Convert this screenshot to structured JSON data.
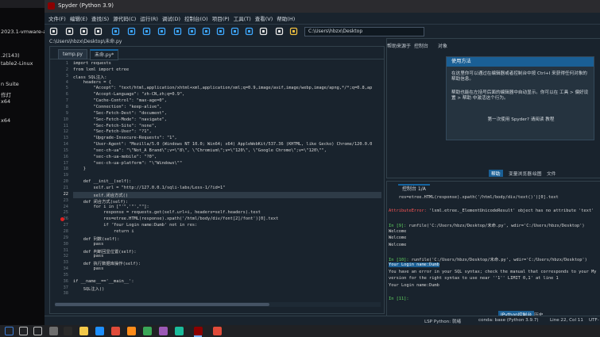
{
  "left_strip": {
    "items": [
      "2023.1-vmware-amd",
      ".2(143)",
      "table2-Linux",
      "n Suite",
      "作灯",
      "x64",
      "x64"
    ]
  },
  "window": {
    "title": "Spyder (Python 3.9)"
  },
  "menu": [
    "文件(F)",
    "编辑(E)",
    "查找(S)",
    "源代码(C)",
    "运行(R)",
    "调试(D)",
    "控制台(O)",
    "项目(P)",
    "工具(T)",
    "查看(V)",
    "帮助(H)"
  ],
  "toolbar": {
    "path": "C:\\Users\\hbzx\\Desktop",
    "icons": [
      "new-file-icon",
      "open-folder-icon",
      "save-icon",
      "save-all-icon",
      "run-file-icon",
      "run-cell-icon",
      "run-cell-advance-icon",
      "run-selection-icon",
      "debug-icon",
      "step-over-icon",
      "step-into-icon",
      "step-return-icon",
      "continue-icon",
      "stop-icon",
      "maximize-icon",
      "wrench-icon",
      "python-path-icon"
    ]
  },
  "breadcrumb": "C:\\Users\\hbzx\\Desktop\\未命.py",
  "editor": {
    "tabs": [
      {
        "label": "temp.py",
        "active": false
      },
      {
        "label": "未命.py*",
        "active": true
      }
    ],
    "lines": [
      {
        "n": "1",
        "t": "import requests"
      },
      {
        "n": "2",
        "t": "from lxml import etree"
      },
      {
        "n": "3",
        "t": "class SQL注入:"
      },
      {
        "n": "4",
        "t": "    headers = {"
      },
      {
        "n": "5",
        "t": "        \"Accept\": \"text/html,application/xhtml+xml,application/xml;q=0.9,image/avif,image/webp,image/apng,*/*;q=0.8,ap"
      },
      {
        "n": "6",
        "t": "        \"Accept-Language\": \"zh-CN,zh;q=0.9\","
      },
      {
        "n": "7",
        "t": "        \"Cache-Control\": \"max-age=0\","
      },
      {
        "n": "8",
        "t": "        \"Connection\": \"keep-alive\","
      },
      {
        "n": "9",
        "t": "        \"Sec-Fetch-Dest\": \"document\","
      },
      {
        "n": "10",
        "t": "        \"Sec-Fetch-Mode\": \"navigate\","
      },
      {
        "n": "11",
        "t": "        \"Sec-Fetch-Site\": \"none\","
      },
      {
        "n": "12",
        "t": "        \"Sec-Fetch-User\": \"?1\","
      },
      {
        "n": "13",
        "t": "        \"Upgrade-Insecure-Requests\": \"1\","
      },
      {
        "n": "14",
        "t": "        \"User-Agent\": \"Mozilla/5.0 (Windows NT 10.0; Win64; x64) AppleWebKit/537.36 (KHTML, like Gecko) Chrome/120.0.0"
      },
      {
        "n": "15",
        "t": "        \"sec-ch-ua\": \"\\\"Not_A Brand\\\";v=\\\"8\\\", \\\"Chromium\\\";v=\\\"120\\\", \\\"Google Chrome\\\";v=\\\"120\\\"\","
      },
      {
        "n": "16",
        "t": "        \"sec-ch-ua-mobile\": \"?0\","
      },
      {
        "n": "17",
        "t": "        \"sec-ch-ua-platform\": \"\\\"Windows\\\"\""
      },
      {
        "n": "18",
        "t": "    }"
      },
      {
        "n": "19",
        "t": ""
      },
      {
        "n": "20",
        "t": "    def __init__(self):"
      },
      {
        "n": "21",
        "t": "        self.url = \"http://127.0.0.1/sqli-labs/Less-1/?id=1\""
      },
      {
        "n": "22",
        "t": "        self.闭合方式()"
      },
      {
        "n": "23",
        "t": "    def 闭合方式(self):"
      },
      {
        "n": "24",
        "t": "        for i in [\"'\",'\"',\"\"]:"
      },
      {
        "n": "25",
        "t": "            response = requests.get(self.url+i, headers=self.headers).text"
      },
      {
        "n": "26",
        "t": "            res=etree.HTML(response).xpath('/html/body/div/font[2]/font')[0].text"
      },
      {
        "n": "27",
        "t": "            if 'Your Login name:Dumb' not in res:"
      },
      {
        "n": "28",
        "t": "                return i"
      },
      {
        "n": "29",
        "t": "    def 列数(self):"
      },
      {
        "n": "30",
        "t": "        pass"
      },
      {
        "n": "31",
        "t": "    def 判断回显位置(self):"
      },
      {
        "n": "32",
        "t": "        pass"
      },
      {
        "n": "33",
        "t": "    def 执行数据库操作(self):"
      },
      {
        "n": "34",
        "t": "        pass"
      },
      {
        "n": "35",
        "t": ""
      },
      {
        "n": "36",
        "t": "if __name__=='__main__':"
      },
      {
        "n": "37",
        "t": "    SQL注入()"
      },
      {
        "n": "38",
        "t": ""
      }
    ]
  },
  "help": {
    "tabs": [
      "帮助来源于",
      "控制台",
      "对象"
    ],
    "box_title": "使用方法",
    "p1": "在这里你可以通过在编辑器或者控制台中按 Ctrl+I 来获得任何对象的帮助信息。",
    "p2": "帮助也能在左括号后面的编辑器中自动显示。你可以在 工具 > 偏好设置 > 帮助 中激活这个行为。",
    "p3": "第一次使用 Spyder? 请阅读 教程",
    "bottom_tabs": [
      {
        "label": "帮助",
        "active": true
      },
      {
        "label": "变量浏览器",
        "active": false
      },
      {
        "label": "绘图",
        "active": false
      },
      {
        "label": "文件",
        "active": false
      }
    ]
  },
  "console": {
    "tab": "控制台 1/A",
    "lines": [
      {
        "segs": [
          {
            "c": "",
            "t": "    res=etree.HTML(response).xpath('/html/body/div/text()')[0].text"
          }
        ]
      },
      {
        "segs": [
          {
            "c": "",
            "t": ""
          }
        ]
      },
      {
        "segs": [
          {
            "c": "r",
            "t": "AttributeError: "
          },
          {
            "c": "",
            "t": "'lxml.etree._ElementUnicodeResult' object has no attribute 'text'"
          }
        ]
      },
      {
        "segs": [
          {
            "c": "",
            "t": ""
          }
        ]
      },
      {
        "segs": [
          {
            "c": "g",
            "t": "In [9]: "
          },
          {
            "c": "",
            "t": "runfile('C:/Users/hbzx/Desktop/未命.py', wdir='C:/Users/hbzx/Desktop')"
          }
        ]
      },
      {
        "segs": [
          {
            "c": "",
            "t": "Welcome"
          }
        ]
      },
      {
        "segs": [
          {
            "c": "",
            "t": "Welcome"
          }
        ]
      },
      {
        "segs": [
          {
            "c": "",
            "t": "Welcome"
          }
        ]
      },
      {
        "segs": [
          {
            "c": "",
            "t": ""
          }
        ]
      },
      {
        "segs": [
          {
            "c": "g",
            "t": "In [10]: "
          },
          {
            "c": "",
            "t": "runfile('C:/Users/hbzx/Desktop/未命.py', wdir='C:/Users/hbzx/Desktop')"
          }
        ]
      },
      {
        "segs": [
          {
            "c": "sel",
            "t": "Your Login name:Dumb"
          }
        ]
      },
      {
        "segs": [
          {
            "c": "",
            "t": "You have an error in your SQL syntax; check the manual that corresponds to your My"
          }
        ]
      },
      {
        "segs": [
          {
            "c": "",
            "t": "version for the right syntax to use near ''1'' LIMIT 0,1' at line 1"
          }
        ]
      },
      {
        "segs": [
          {
            "c": "",
            "t": "Your Login name:Dumb"
          }
        ]
      },
      {
        "segs": [
          {
            "c": "",
            "t": ""
          }
        ]
      },
      {
        "segs": [
          {
            "c": "g",
            "t": "In [11]: "
          }
        ]
      }
    ],
    "bottom_tabs": [
      {
        "label": "IPython控制台",
        "active": true
      },
      {
        "label": "历史",
        "active": false
      }
    ]
  },
  "status": {
    "lsp": "LSP Python: 就绪",
    "conda": "conda: base (Python 3.9.7)",
    "pos": "Line 22, Col 11",
    "enc": "UTF-"
  },
  "taskbar": {
    "icons": [
      "start-icon",
      "search-icon",
      "task-view-icon",
      "vmware-icon",
      "terminal-icon",
      "explorer-icon",
      "edge-icon",
      "chrome-icon",
      "firefox-icon",
      "app-icon",
      "app-icon-2",
      "app-icon-3",
      "spyder-icon",
      "chrome-icon-2"
    ]
  }
}
